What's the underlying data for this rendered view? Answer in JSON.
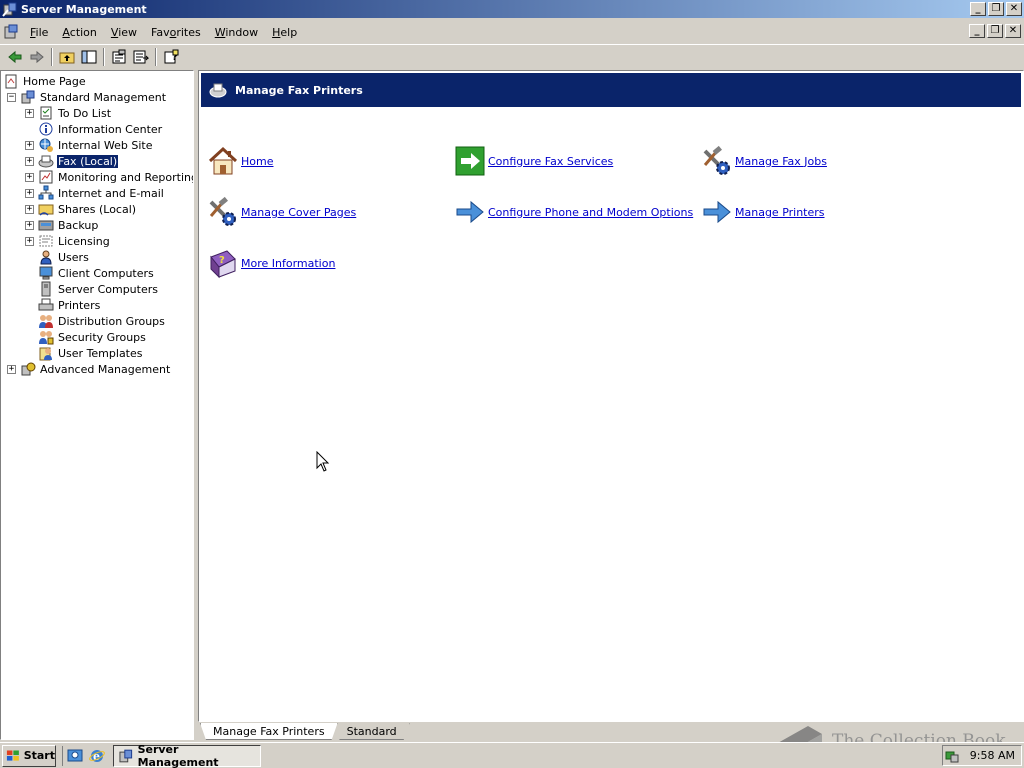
{
  "window": {
    "title": "Server Management"
  },
  "menu": {
    "items": [
      {
        "label": "File",
        "accel": "F",
        "rest": "ile"
      },
      {
        "label": "Action",
        "accel": "A",
        "rest": "ction"
      },
      {
        "label": "View",
        "accel": "V",
        "rest": "iew"
      },
      {
        "label": "Favorites",
        "accel": "",
        "pre": "Fav",
        "accelMid": "o",
        "rest": "rites"
      },
      {
        "label": "Window",
        "accel": "W",
        "rest": "indow"
      },
      {
        "label": "Help",
        "accel": "H",
        "rest": "elp"
      }
    ]
  },
  "tree": {
    "root": {
      "label": "Home Page"
    },
    "standard": {
      "label": "Standard Management"
    },
    "items": [
      {
        "label": "To Do List",
        "expandable": true
      },
      {
        "label": "Information Center",
        "expandable": false
      },
      {
        "label": "Internal Web Site",
        "expandable": true
      },
      {
        "label": "Fax (Local)",
        "expandable": true,
        "selected": true
      },
      {
        "label": "Monitoring and Reporting",
        "expandable": true
      },
      {
        "label": "Internet and E-mail",
        "expandable": true
      },
      {
        "label": "Shares (Local)",
        "expandable": true
      },
      {
        "label": "Backup",
        "expandable": true
      },
      {
        "label": "Licensing",
        "expandable": true
      },
      {
        "label": "Users",
        "expandable": false
      },
      {
        "label": "Client Computers",
        "expandable": false
      },
      {
        "label": "Server Computers",
        "expandable": false
      },
      {
        "label": "Printers",
        "expandable": false
      },
      {
        "label": "Distribution Groups",
        "expandable": false
      },
      {
        "label": "Security Groups",
        "expandable": false
      },
      {
        "label": "User Templates",
        "expandable": false
      }
    ],
    "advanced": {
      "label": "Advanced Management"
    }
  },
  "taskpad": {
    "title": "Manage Fax Printers",
    "tasks": {
      "home": "Home",
      "configure_fax_services": "Configure Fax Services",
      "manage_fax_jobs": "Manage Fax Jobs",
      "manage_cover_pages": "Manage Cover Pages",
      "configure_phone_modem": "Configure Phone and Modem Options",
      "manage_printers": "Manage Printers",
      "more_information": "More Information"
    }
  },
  "tabs": [
    {
      "label": "Manage Fax Printers",
      "active": true
    },
    {
      "label": "Standard",
      "active": false
    }
  ],
  "taskbar": {
    "start": "Start",
    "task": "Server Management",
    "clock": "9:58 AM"
  },
  "watermark": "The Collection Book",
  "colors": {
    "header_blue": "#0a246a",
    "link": "#0000cc",
    "selection": "#0a246a"
  }
}
